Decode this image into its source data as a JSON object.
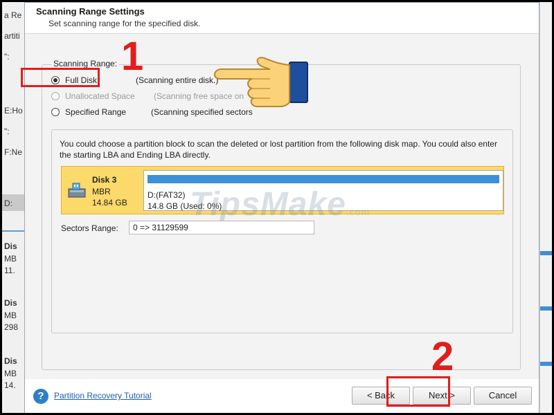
{
  "background_app": {
    "items": [
      "a Re",
      "artiti",
      "\":",
      "E:Ho",
      "\":",
      "F:Ne",
      "D:",
      "Dis",
      "MB",
      "11.",
      "Dis",
      "MB",
      "298",
      "Dis",
      "MB",
      "14."
    ]
  },
  "dialog": {
    "title": "Scanning Range Settings",
    "subtitle": "Set scanning range for the specified disk.",
    "group_label": "Scanning Range:",
    "options": [
      {
        "label": "Full Disk",
        "desc": "(Scanning entire disk.)",
        "checked": true,
        "enabled": true
      },
      {
        "label": "Unallocated Space",
        "desc": "(Scanning free space on",
        "checked": false,
        "enabled": false
      },
      {
        "label": "Specified Range",
        "desc": "(Scanning specified sectors",
        "checked": false,
        "enabled": true
      }
    ],
    "info_text": "You could choose a partition block to scan the deleted or lost partition from the following disk map. You could also enter the starting LBA and Ending LBA directly.",
    "disk": {
      "name": "Disk 3",
      "type": "MBR",
      "size": "14.84 GB",
      "partition": {
        "name": "D:(FAT32)",
        "usage": "14.8 GB (Used: 0%)"
      }
    },
    "sectors_label": "Sectors Range:",
    "sectors_value": "0 => 31129599",
    "footer": {
      "tutorial_link": "Partition Recovery Tutorial",
      "back": "< Back",
      "next": "Next >",
      "cancel": "Cancel"
    }
  },
  "annotations": {
    "step1": "1",
    "step2": "2"
  },
  "watermark": {
    "text": "TipsMake",
    "suffix": ".com"
  },
  "colors": {
    "highlight": "#e11d1d",
    "disk_block": "#fbd96a",
    "partition_bar": "#3d8fd6",
    "link": "#1a5fb4"
  }
}
